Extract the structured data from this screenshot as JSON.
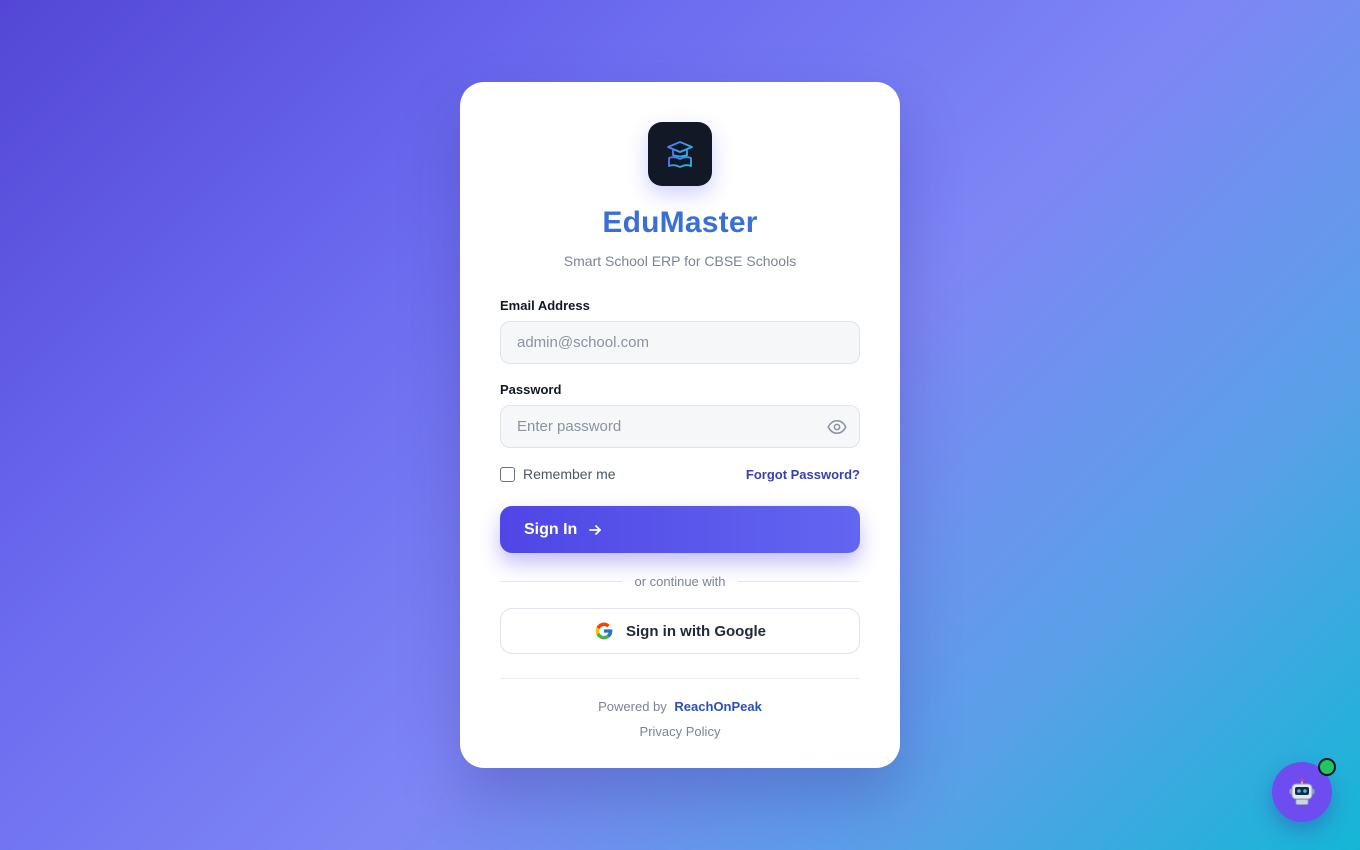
{
  "brand": {
    "name": "EduMaster",
    "tagline": "Smart School ERP for CBSE Schools",
    "logo_icon": "graduation-cap-book-icon"
  },
  "form": {
    "email_label": "Email Address",
    "email_placeholder": "admin@school.com",
    "email_value": "",
    "password_label": "Password",
    "password_placeholder": "Enter password",
    "password_value": "",
    "remember_label": "Remember me",
    "remember_checked": false,
    "forgot_label": "Forgot Password?",
    "signin_label": "Sign In",
    "divider_text": "or continue with",
    "google_label": "Sign in with Google"
  },
  "footer": {
    "powered_by": "Powered by",
    "company": "ReachOnPeak",
    "privacy": "Privacy Policy"
  },
  "colors": {
    "primary": "#4f46e5",
    "brand_text": "#3a6fd8",
    "status_online": "#22c55e"
  }
}
